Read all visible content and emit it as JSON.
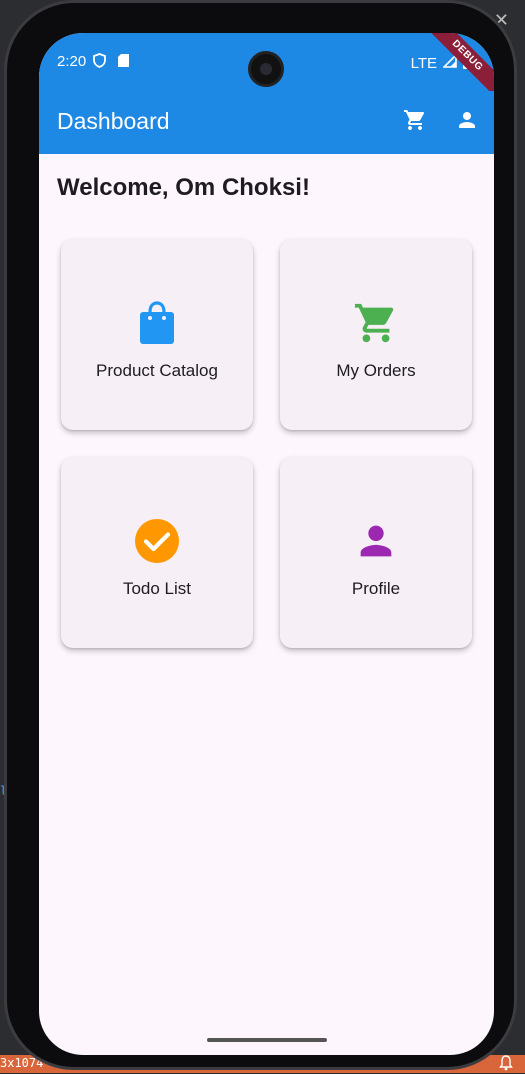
{
  "status_bar": {
    "time": "2:20",
    "network": "LTE",
    "debug_banner": "DEBUG"
  },
  "app_bar": {
    "title": "Dashboard",
    "actions": [
      {
        "icon": "cart-icon"
      },
      {
        "icon": "person-icon"
      }
    ]
  },
  "welcome": "Welcome, Om Choksi!",
  "cards": [
    {
      "label": "Product Catalog",
      "icon": "shopping-bag-icon",
      "color": "#2196f3"
    },
    {
      "label": "My Orders",
      "icon": "cart-icon",
      "color": "#4caf50"
    },
    {
      "label": "Todo List",
      "icon": "check-circle-icon",
      "color": "#ff9800"
    },
    {
      "label": "Profile",
      "icon": "person-icon",
      "color": "#9c27b0"
    }
  ],
  "window": {
    "dims_text": "3x1074"
  },
  "colors": {
    "app_bar": "#1e88e5",
    "background": "#fdf7fd",
    "card": "#f6f0f6"
  }
}
